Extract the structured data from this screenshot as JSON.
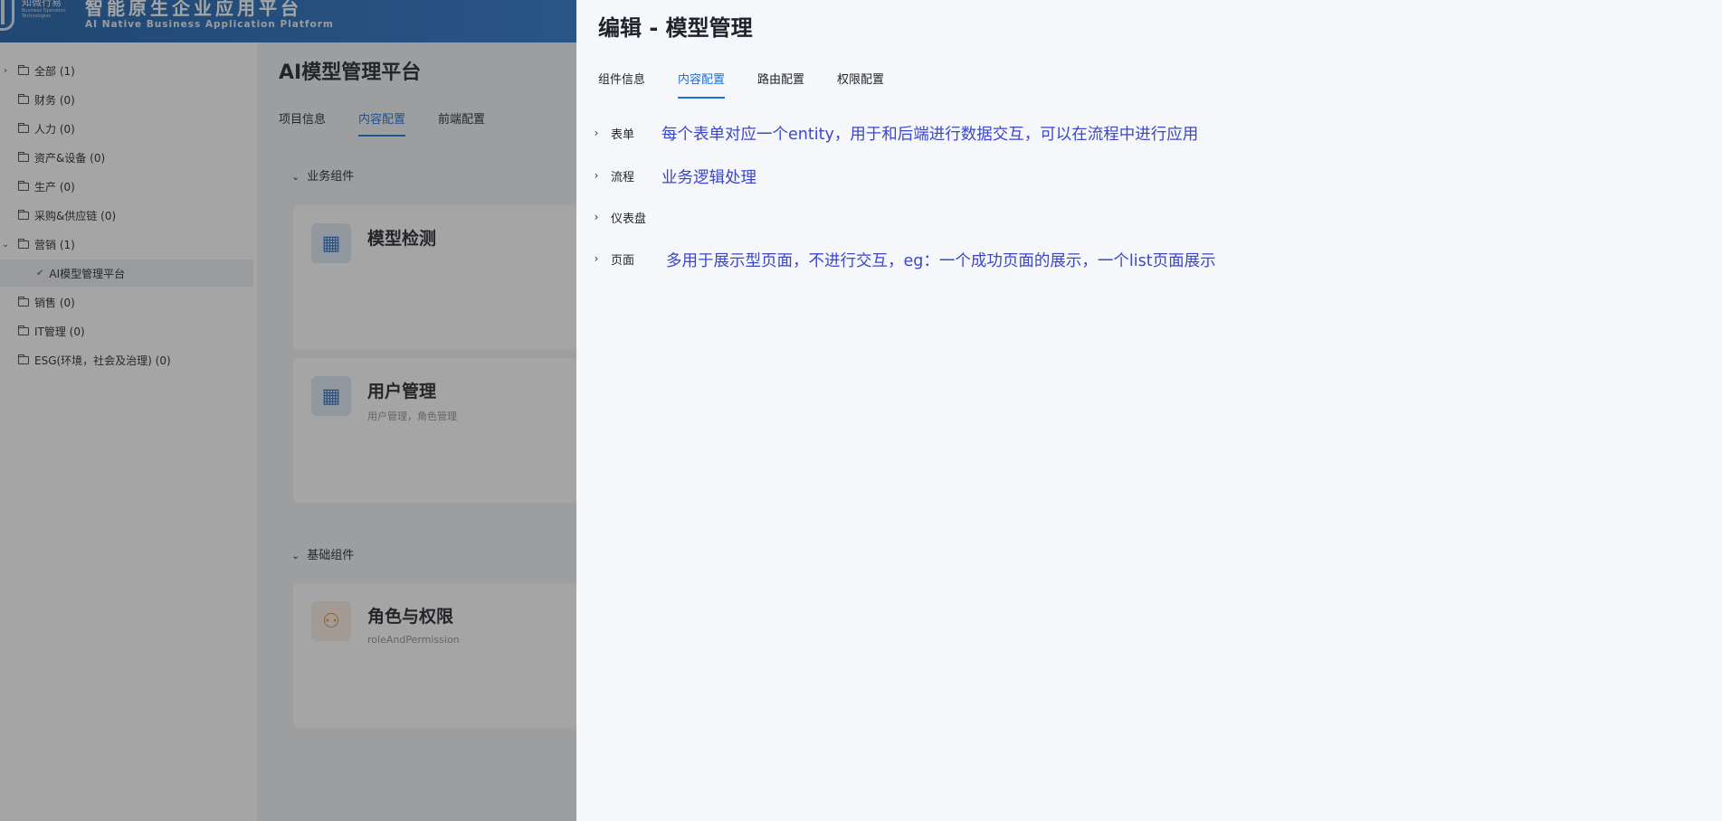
{
  "header": {
    "brand_name": "知微行易",
    "brand_sub": "Business Operation Technologies",
    "app_title": "智能原生企业应用平台",
    "app_subtitle": "AI Native Business Application Platform"
  },
  "sidebar": {
    "items": [
      {
        "label": "全部 (1)",
        "toggle": "›"
      },
      {
        "label": "财务 (0)"
      },
      {
        "label": "人力 (0)"
      },
      {
        "label": "资产&设备 (0)"
      },
      {
        "label": "生产 (0)"
      },
      {
        "label": "采购&供应链 (0)"
      },
      {
        "label": "营销 (1)",
        "toggle": "⌄"
      },
      {
        "label": "AI模型管理平台"
      },
      {
        "label": "销售 (0)"
      },
      {
        "label": "IT管理 (0)"
      },
      {
        "label": "ESG(环境，社会及治理) (0)"
      }
    ]
  },
  "main": {
    "title": "AI模型管理平台",
    "tabs": [
      {
        "label": "项目信息"
      },
      {
        "label": "内容配置"
      },
      {
        "label": "前端配置"
      }
    ],
    "sections": [
      {
        "label": "业务组件"
      },
      {
        "label": "基础组件"
      }
    ],
    "cards": [
      {
        "title": "模型检测",
        "desc": "",
        "icon": "building-icon"
      },
      {
        "title": "用户管理",
        "desc": "用户管理，角色管理",
        "icon": "building-icon"
      },
      {
        "title": "角色与权限",
        "desc": "roleAndPermission",
        "icon": "user-gear-icon"
      }
    ]
  },
  "drawer": {
    "title": "编辑 - 模型管理",
    "tabs": [
      {
        "label": "组件信息"
      },
      {
        "label": "内容配置"
      },
      {
        "label": "路由配置"
      },
      {
        "label": "权限配置"
      }
    ],
    "rows": [
      {
        "label": "表单",
        "note": "每个表单对应一个entity，用于和后端进行数据交互，可以在流程中进行应用"
      },
      {
        "label": "流程",
        "note": "业务逻辑处理"
      },
      {
        "label": "仪表盘",
        "note": ""
      },
      {
        "label": "页面",
        "note": "多用于展示型页面，不进行交互，eg：一个成功页面的展示，一个list页面展示"
      }
    ]
  },
  "colors": {
    "accent": "#1e6fd9",
    "annotation": "#3b47c8",
    "header": "#2d7bd0"
  }
}
